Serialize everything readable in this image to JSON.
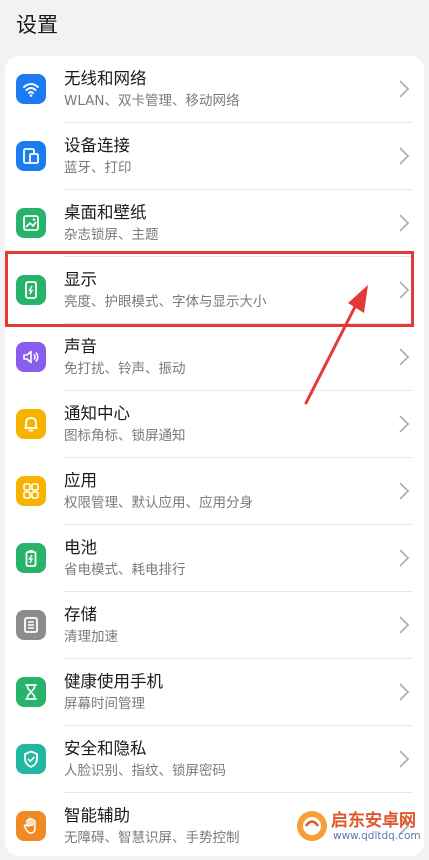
{
  "header": {
    "title": "设置"
  },
  "settings": {
    "items": [
      {
        "title": "无线和网络",
        "subtitle": "WLAN、双卡管理、移动网络",
        "icon": "wifi-icon",
        "color": "#1a7cf0"
      },
      {
        "title": "设备连接",
        "subtitle": "蓝牙、打印",
        "icon": "device-connect-icon",
        "color": "#1a7cf0"
      },
      {
        "title": "桌面和壁纸",
        "subtitle": "杂志锁屏、主题",
        "icon": "wallpaper-icon",
        "color": "#27b36a"
      },
      {
        "title": "显示",
        "subtitle": "亮度、护眼模式、字体与显示大小",
        "icon": "display-icon",
        "color": "#27b36a"
      },
      {
        "title": "声音",
        "subtitle": "免打扰、铃声、振动",
        "icon": "speaker-icon",
        "color": "#8a5cf0"
      },
      {
        "title": "通知中心",
        "subtitle": "图标角标、锁屏通知",
        "icon": "bell-icon",
        "color": "#f6b400"
      },
      {
        "title": "应用",
        "subtitle": "权限管理、默认应用、应用分身",
        "icon": "apps-grid-icon",
        "color": "#f6b400"
      },
      {
        "title": "电池",
        "subtitle": "省电模式、耗电排行",
        "icon": "battery-icon",
        "color": "#27b36a"
      },
      {
        "title": "存储",
        "subtitle": "清理加速",
        "icon": "storage-icon",
        "color": "#8c8c8c"
      },
      {
        "title": "健康使用手机",
        "subtitle": "屏幕时间管理",
        "icon": "hourglass-icon",
        "color": "#27b36a"
      },
      {
        "title": "安全和隐私",
        "subtitle": "人脸识别、指纹、锁屏密码",
        "icon": "shield-icon",
        "color": "#20b8a0"
      },
      {
        "title": "智能辅助",
        "subtitle": "无障碍、智慧识屏、手势控制",
        "icon": "hand-icon",
        "color": "#f08a24"
      }
    ]
  },
  "watermark": {
    "name": "启东安卓网",
    "url": "www.qdltdq.com"
  },
  "annotation_color": "#e53935"
}
